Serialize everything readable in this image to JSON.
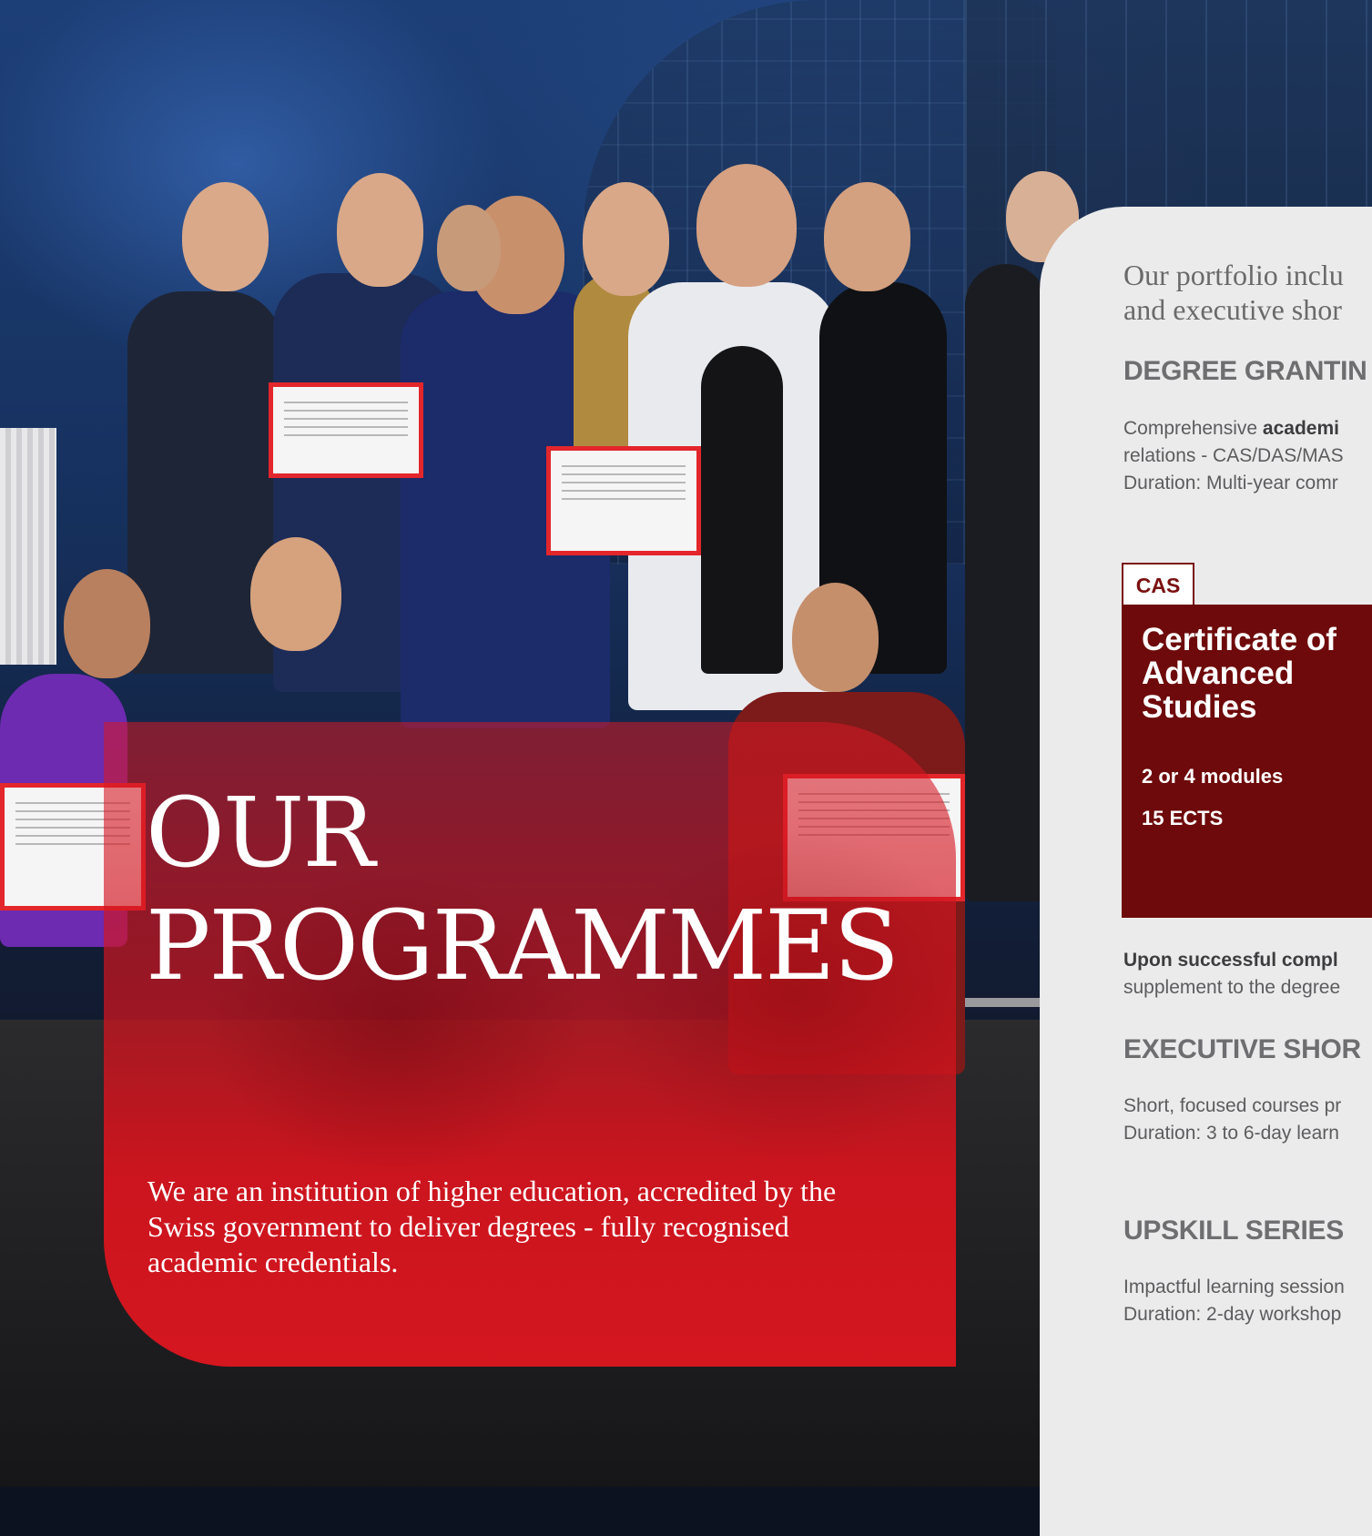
{
  "hero": {
    "title_line1": "OUR",
    "title_line2": "PROGRAMMES",
    "description": "We are an institution of higher education, accredited by the Swiss government to deliver degrees - fully recognised academic credentials."
  },
  "panel": {
    "intro_line1": "Our portfolio inclu",
    "intro_line2": "and executive shor",
    "degree": {
      "heading": "DEGREE GRANTIN",
      "line1_pre": "Comprehensive ",
      "line1_bold": "academi",
      "line2": "relations - CAS/DAS/MAS",
      "line3": "Duration: Multi-year comr"
    },
    "cas": {
      "tag": "CAS",
      "title": "Certificate of Advanced Studies",
      "modules": "2 or 4 modules",
      "ects": "15 ECTS"
    },
    "upon": {
      "bold": "Upon successful compl",
      "line2": "supplement to the degree"
    },
    "executive": {
      "heading": "EXECUTIVE SHOR",
      "line1": "Short, focused courses pr",
      "line2": "Duration: 3 to 6-day learn"
    },
    "upskill": {
      "heading": "UPSKILL SERIES",
      "line1": "Impactful learning session",
      "line2": "Duration: 2-day workshop"
    }
  },
  "colors": {
    "hero_red": "#d4161f",
    "card_maroon": "#6e0a0b",
    "panel_grey": "#ebebec"
  }
}
